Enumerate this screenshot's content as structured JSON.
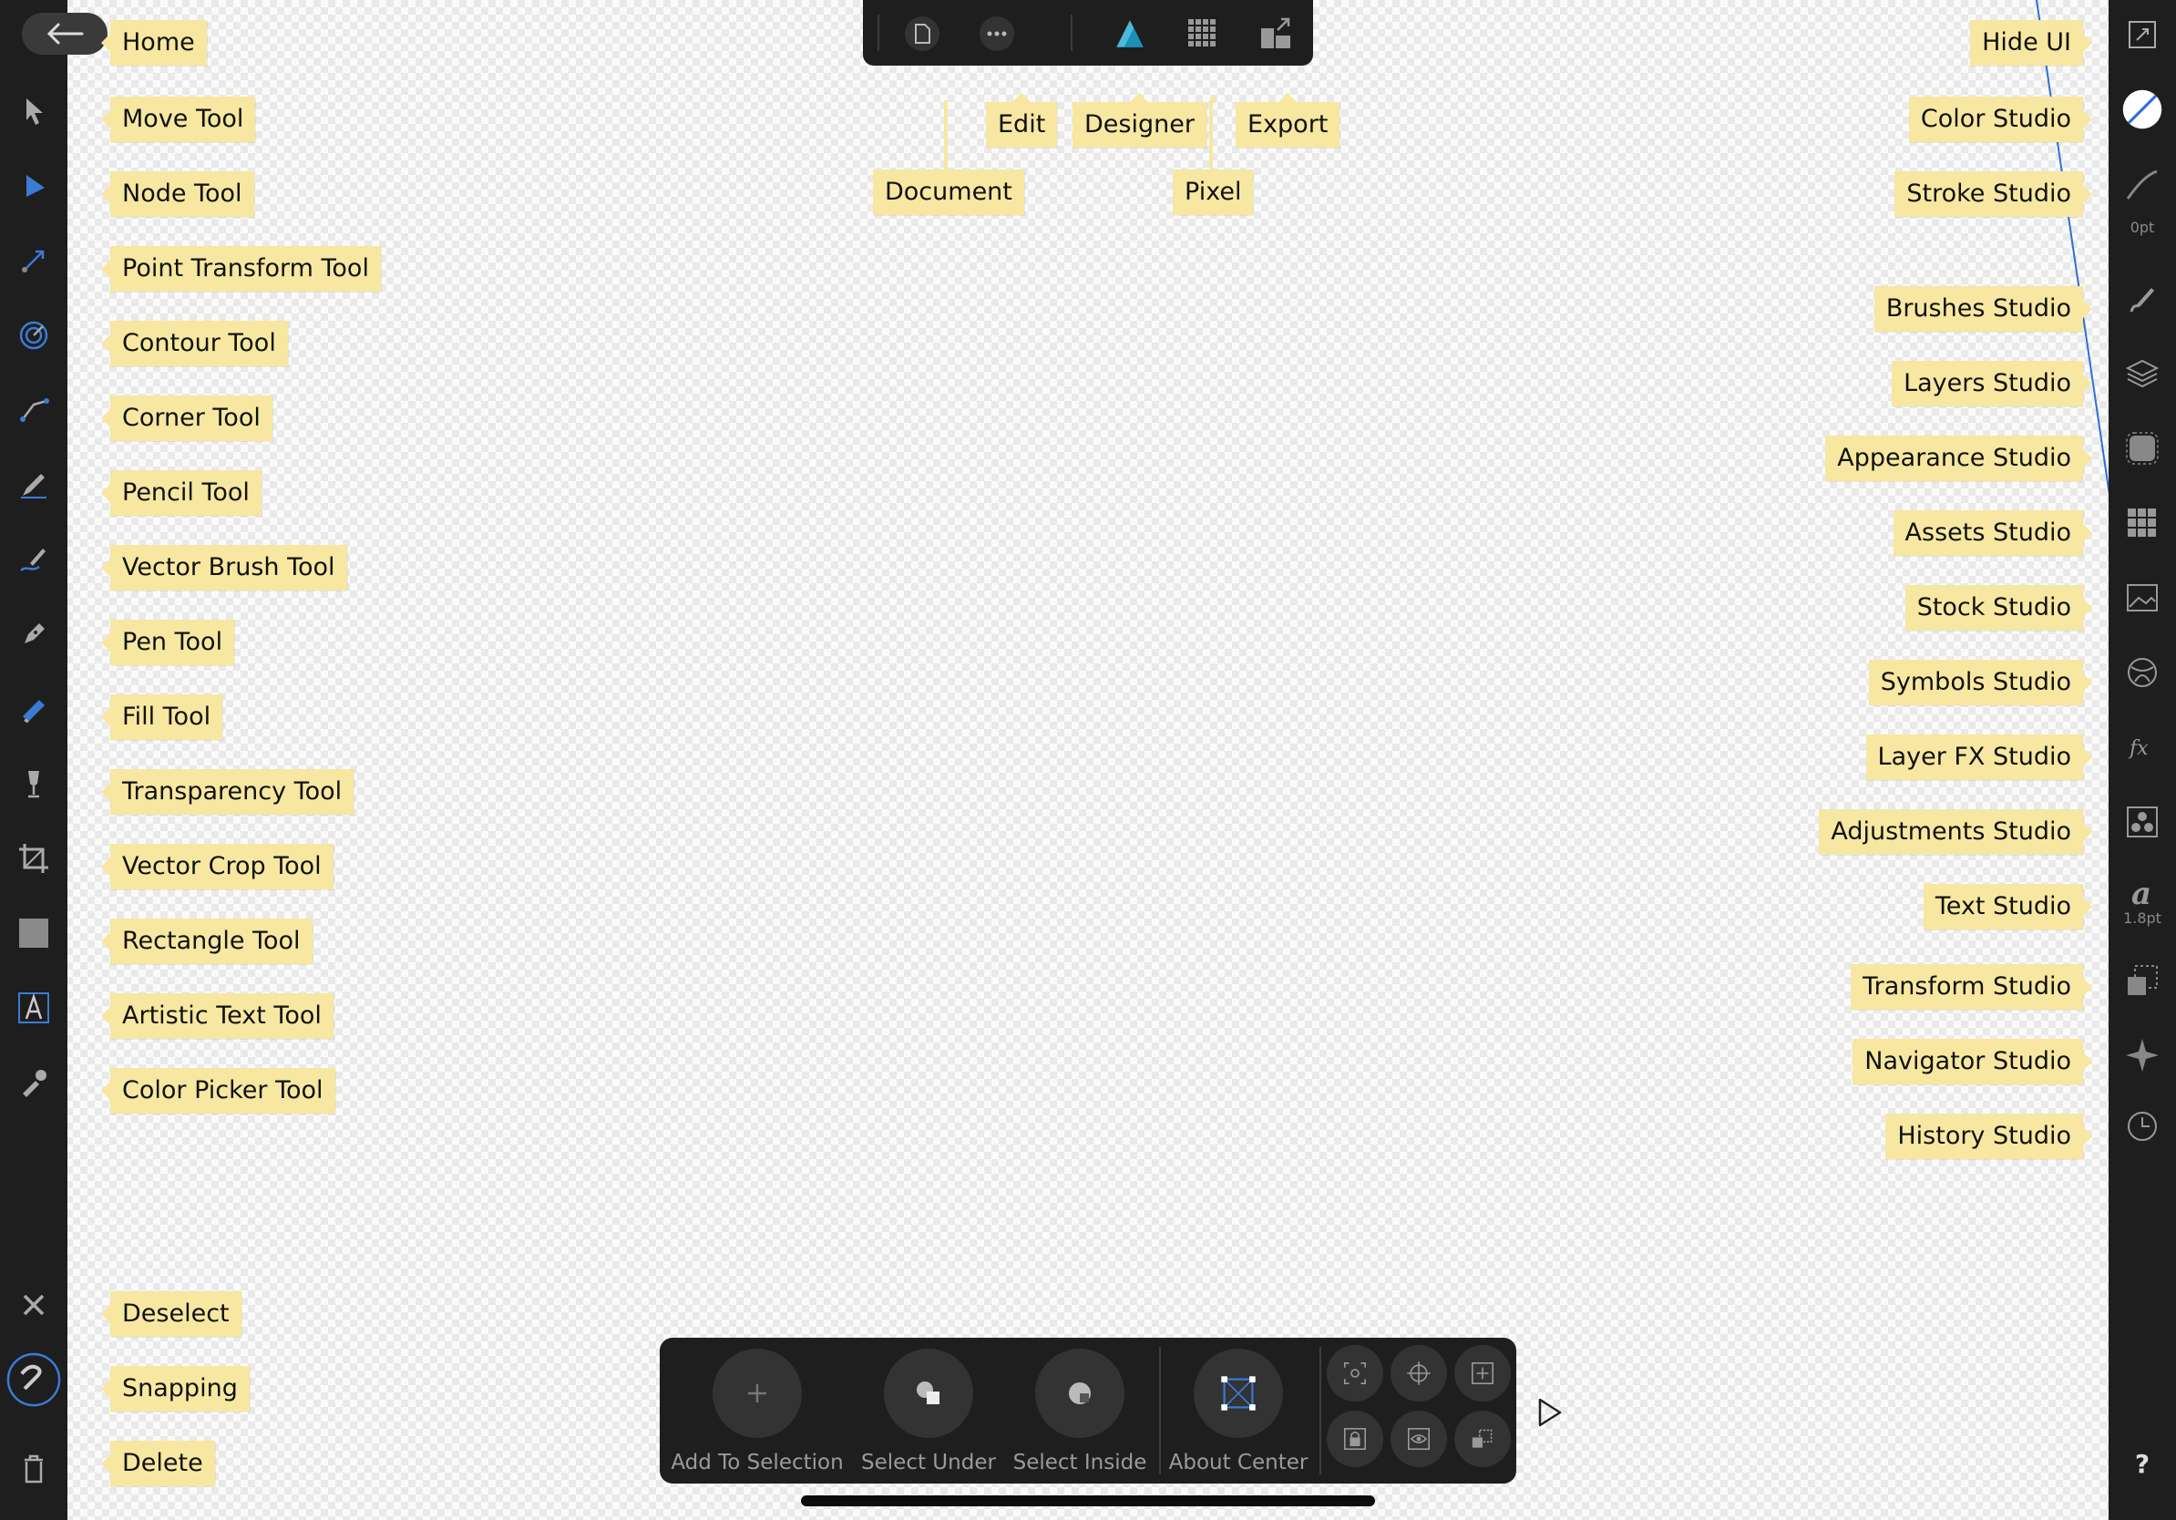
{
  "top_labels": {
    "document": "Document",
    "edit": "Edit",
    "designer": "Designer",
    "pixel": "Pixel",
    "export": "Export"
  },
  "left_labels": {
    "home": "Home",
    "move": "Move Tool",
    "node": "Node Tool",
    "point_transform": "Point Transform Tool",
    "contour": "Contour Tool",
    "corner": "Corner Tool",
    "pencil": "Pencil Tool",
    "vector_brush": "Vector Brush Tool",
    "pen": "Pen Tool",
    "fill": "Fill Tool",
    "transparency": "Transparency Tool",
    "vector_crop": "Vector Crop Tool",
    "rectangle": "Rectangle Tool",
    "artistic_text": "Artistic Text Tool",
    "color_picker": "Color Picker Tool",
    "deselect": "Deselect",
    "snapping": "Snapping",
    "delete": "Delete"
  },
  "right_labels": {
    "hide_ui": "Hide UI",
    "color": "Color Studio",
    "stroke": "Stroke Studio",
    "brushes": "Brushes Studio",
    "layers": "Layers Studio",
    "appearance": "Appearance Studio",
    "assets": "Assets Studio",
    "stock": "Stock Studio",
    "symbols": "Symbols Studio",
    "layer_fx": "Layer FX Studio",
    "adjustments": "Adjustments Studio",
    "text": "Text Studio",
    "transform": "Transform Studio",
    "navigator": "Navigator Studio",
    "history": "History Studio"
  },
  "right_sub": {
    "stroke_width": "0pt",
    "text_size": "1.8pt",
    "help": "?"
  },
  "context_toolbar": {
    "add_to_selection": "Add To Selection",
    "select_under": "Select Under",
    "select_inside": "Select Inside",
    "about_center": "About Center"
  },
  "colors": {
    "accent_blue": "#2f6fd6",
    "callout_bg": "#f7e7a1",
    "panel_bg": "#1e1e1e"
  }
}
